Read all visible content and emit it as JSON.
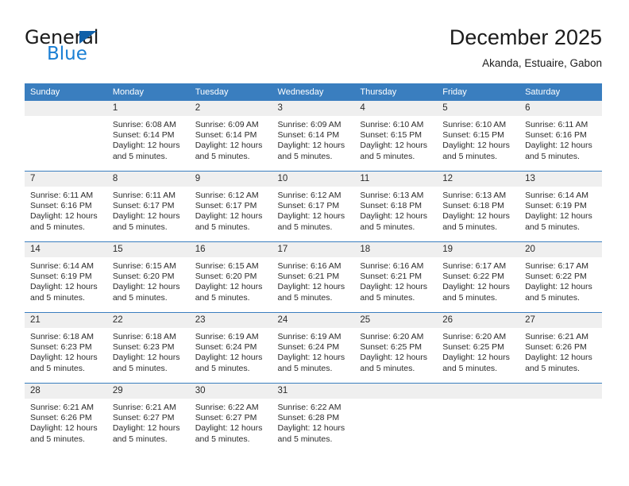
{
  "brand": {
    "name_part1": "General",
    "name_part2": "Blue",
    "accent_color": "#1a7fd4",
    "triangle_color": "#1060a8"
  },
  "header": {
    "title": "December 2025",
    "subtitle": "Akanda, Estuaire, Gabon"
  },
  "theme": {
    "header_row_bg": "#3a7ebf",
    "day_number_bg": "#efefef",
    "grid_line": "#3a7ebf",
    "text": "#2b2b2b"
  },
  "weekday_headers": [
    "Sunday",
    "Monday",
    "Tuesday",
    "Wednesday",
    "Thursday",
    "Friday",
    "Saturday"
  ],
  "weeks": [
    [
      {
        "day": "",
        "blank": true,
        "sunrise": "",
        "sunset": "",
        "daylight_line1": "",
        "daylight_line2": ""
      },
      {
        "day": "1",
        "blank": false,
        "sunrise": "Sunrise: 6:08 AM",
        "sunset": "Sunset: 6:14 PM",
        "daylight_line1": "Daylight: 12 hours",
        "daylight_line2": "and 5 minutes."
      },
      {
        "day": "2",
        "blank": false,
        "sunrise": "Sunrise: 6:09 AM",
        "sunset": "Sunset: 6:14 PM",
        "daylight_line1": "Daylight: 12 hours",
        "daylight_line2": "and 5 minutes."
      },
      {
        "day": "3",
        "blank": false,
        "sunrise": "Sunrise: 6:09 AM",
        "sunset": "Sunset: 6:14 PM",
        "daylight_line1": "Daylight: 12 hours",
        "daylight_line2": "and 5 minutes."
      },
      {
        "day": "4",
        "blank": false,
        "sunrise": "Sunrise: 6:10 AM",
        "sunset": "Sunset: 6:15 PM",
        "daylight_line1": "Daylight: 12 hours",
        "daylight_line2": "and 5 minutes."
      },
      {
        "day": "5",
        "blank": false,
        "sunrise": "Sunrise: 6:10 AM",
        "sunset": "Sunset: 6:15 PM",
        "daylight_line1": "Daylight: 12 hours",
        "daylight_line2": "and 5 minutes."
      },
      {
        "day": "6",
        "blank": false,
        "sunrise": "Sunrise: 6:11 AM",
        "sunset": "Sunset: 6:16 PM",
        "daylight_line1": "Daylight: 12 hours",
        "daylight_line2": "and 5 minutes."
      }
    ],
    [
      {
        "day": "7",
        "blank": false,
        "sunrise": "Sunrise: 6:11 AM",
        "sunset": "Sunset: 6:16 PM",
        "daylight_line1": "Daylight: 12 hours",
        "daylight_line2": "and 5 minutes."
      },
      {
        "day": "8",
        "blank": false,
        "sunrise": "Sunrise: 6:11 AM",
        "sunset": "Sunset: 6:17 PM",
        "daylight_line1": "Daylight: 12 hours",
        "daylight_line2": "and 5 minutes."
      },
      {
        "day": "9",
        "blank": false,
        "sunrise": "Sunrise: 6:12 AM",
        "sunset": "Sunset: 6:17 PM",
        "daylight_line1": "Daylight: 12 hours",
        "daylight_line2": "and 5 minutes."
      },
      {
        "day": "10",
        "blank": false,
        "sunrise": "Sunrise: 6:12 AM",
        "sunset": "Sunset: 6:17 PM",
        "daylight_line1": "Daylight: 12 hours",
        "daylight_line2": "and 5 minutes."
      },
      {
        "day": "11",
        "blank": false,
        "sunrise": "Sunrise: 6:13 AM",
        "sunset": "Sunset: 6:18 PM",
        "daylight_line1": "Daylight: 12 hours",
        "daylight_line2": "and 5 minutes."
      },
      {
        "day": "12",
        "blank": false,
        "sunrise": "Sunrise: 6:13 AM",
        "sunset": "Sunset: 6:18 PM",
        "daylight_line1": "Daylight: 12 hours",
        "daylight_line2": "and 5 minutes."
      },
      {
        "day": "13",
        "blank": false,
        "sunrise": "Sunrise: 6:14 AM",
        "sunset": "Sunset: 6:19 PM",
        "daylight_line1": "Daylight: 12 hours",
        "daylight_line2": "and 5 minutes."
      }
    ],
    [
      {
        "day": "14",
        "blank": false,
        "sunrise": "Sunrise: 6:14 AM",
        "sunset": "Sunset: 6:19 PM",
        "daylight_line1": "Daylight: 12 hours",
        "daylight_line2": "and 5 minutes."
      },
      {
        "day": "15",
        "blank": false,
        "sunrise": "Sunrise: 6:15 AM",
        "sunset": "Sunset: 6:20 PM",
        "daylight_line1": "Daylight: 12 hours",
        "daylight_line2": "and 5 minutes."
      },
      {
        "day": "16",
        "blank": false,
        "sunrise": "Sunrise: 6:15 AM",
        "sunset": "Sunset: 6:20 PM",
        "daylight_line1": "Daylight: 12 hours",
        "daylight_line2": "and 5 minutes."
      },
      {
        "day": "17",
        "blank": false,
        "sunrise": "Sunrise: 6:16 AM",
        "sunset": "Sunset: 6:21 PM",
        "daylight_line1": "Daylight: 12 hours",
        "daylight_line2": "and 5 minutes."
      },
      {
        "day": "18",
        "blank": false,
        "sunrise": "Sunrise: 6:16 AM",
        "sunset": "Sunset: 6:21 PM",
        "daylight_line1": "Daylight: 12 hours",
        "daylight_line2": "and 5 minutes."
      },
      {
        "day": "19",
        "blank": false,
        "sunrise": "Sunrise: 6:17 AM",
        "sunset": "Sunset: 6:22 PM",
        "daylight_line1": "Daylight: 12 hours",
        "daylight_line2": "and 5 minutes."
      },
      {
        "day": "20",
        "blank": false,
        "sunrise": "Sunrise: 6:17 AM",
        "sunset": "Sunset: 6:22 PM",
        "daylight_line1": "Daylight: 12 hours",
        "daylight_line2": "and 5 minutes."
      }
    ],
    [
      {
        "day": "21",
        "blank": false,
        "sunrise": "Sunrise: 6:18 AM",
        "sunset": "Sunset: 6:23 PM",
        "daylight_line1": "Daylight: 12 hours",
        "daylight_line2": "and 5 minutes."
      },
      {
        "day": "22",
        "blank": false,
        "sunrise": "Sunrise: 6:18 AM",
        "sunset": "Sunset: 6:23 PM",
        "daylight_line1": "Daylight: 12 hours",
        "daylight_line2": "and 5 minutes."
      },
      {
        "day": "23",
        "blank": false,
        "sunrise": "Sunrise: 6:19 AM",
        "sunset": "Sunset: 6:24 PM",
        "daylight_line1": "Daylight: 12 hours",
        "daylight_line2": "and 5 minutes."
      },
      {
        "day": "24",
        "blank": false,
        "sunrise": "Sunrise: 6:19 AM",
        "sunset": "Sunset: 6:24 PM",
        "daylight_line1": "Daylight: 12 hours",
        "daylight_line2": "and 5 minutes."
      },
      {
        "day": "25",
        "blank": false,
        "sunrise": "Sunrise: 6:20 AM",
        "sunset": "Sunset: 6:25 PM",
        "daylight_line1": "Daylight: 12 hours",
        "daylight_line2": "and 5 minutes."
      },
      {
        "day": "26",
        "blank": false,
        "sunrise": "Sunrise: 6:20 AM",
        "sunset": "Sunset: 6:25 PM",
        "daylight_line1": "Daylight: 12 hours",
        "daylight_line2": "and 5 minutes."
      },
      {
        "day": "27",
        "blank": false,
        "sunrise": "Sunrise: 6:21 AM",
        "sunset": "Sunset: 6:26 PM",
        "daylight_line1": "Daylight: 12 hours",
        "daylight_line2": "and 5 minutes."
      }
    ],
    [
      {
        "day": "28",
        "blank": false,
        "sunrise": "Sunrise: 6:21 AM",
        "sunset": "Sunset: 6:26 PM",
        "daylight_line1": "Daylight: 12 hours",
        "daylight_line2": "and 5 minutes."
      },
      {
        "day": "29",
        "blank": false,
        "sunrise": "Sunrise: 6:21 AM",
        "sunset": "Sunset: 6:27 PM",
        "daylight_line1": "Daylight: 12 hours",
        "daylight_line2": "and 5 minutes."
      },
      {
        "day": "30",
        "blank": false,
        "sunrise": "Sunrise: 6:22 AM",
        "sunset": "Sunset: 6:27 PM",
        "daylight_line1": "Daylight: 12 hours",
        "daylight_line2": "and 5 minutes."
      },
      {
        "day": "31",
        "blank": false,
        "sunrise": "Sunrise: 6:22 AM",
        "sunset": "Sunset: 6:28 PM",
        "daylight_line1": "Daylight: 12 hours",
        "daylight_line2": "and 5 minutes."
      },
      {
        "day": "",
        "blank": true,
        "sunrise": "",
        "sunset": "",
        "daylight_line1": "",
        "daylight_line2": ""
      },
      {
        "day": "",
        "blank": true,
        "sunrise": "",
        "sunset": "",
        "daylight_line1": "",
        "daylight_line2": ""
      },
      {
        "day": "",
        "blank": true,
        "sunrise": "",
        "sunset": "",
        "daylight_line1": "",
        "daylight_line2": ""
      }
    ]
  ]
}
